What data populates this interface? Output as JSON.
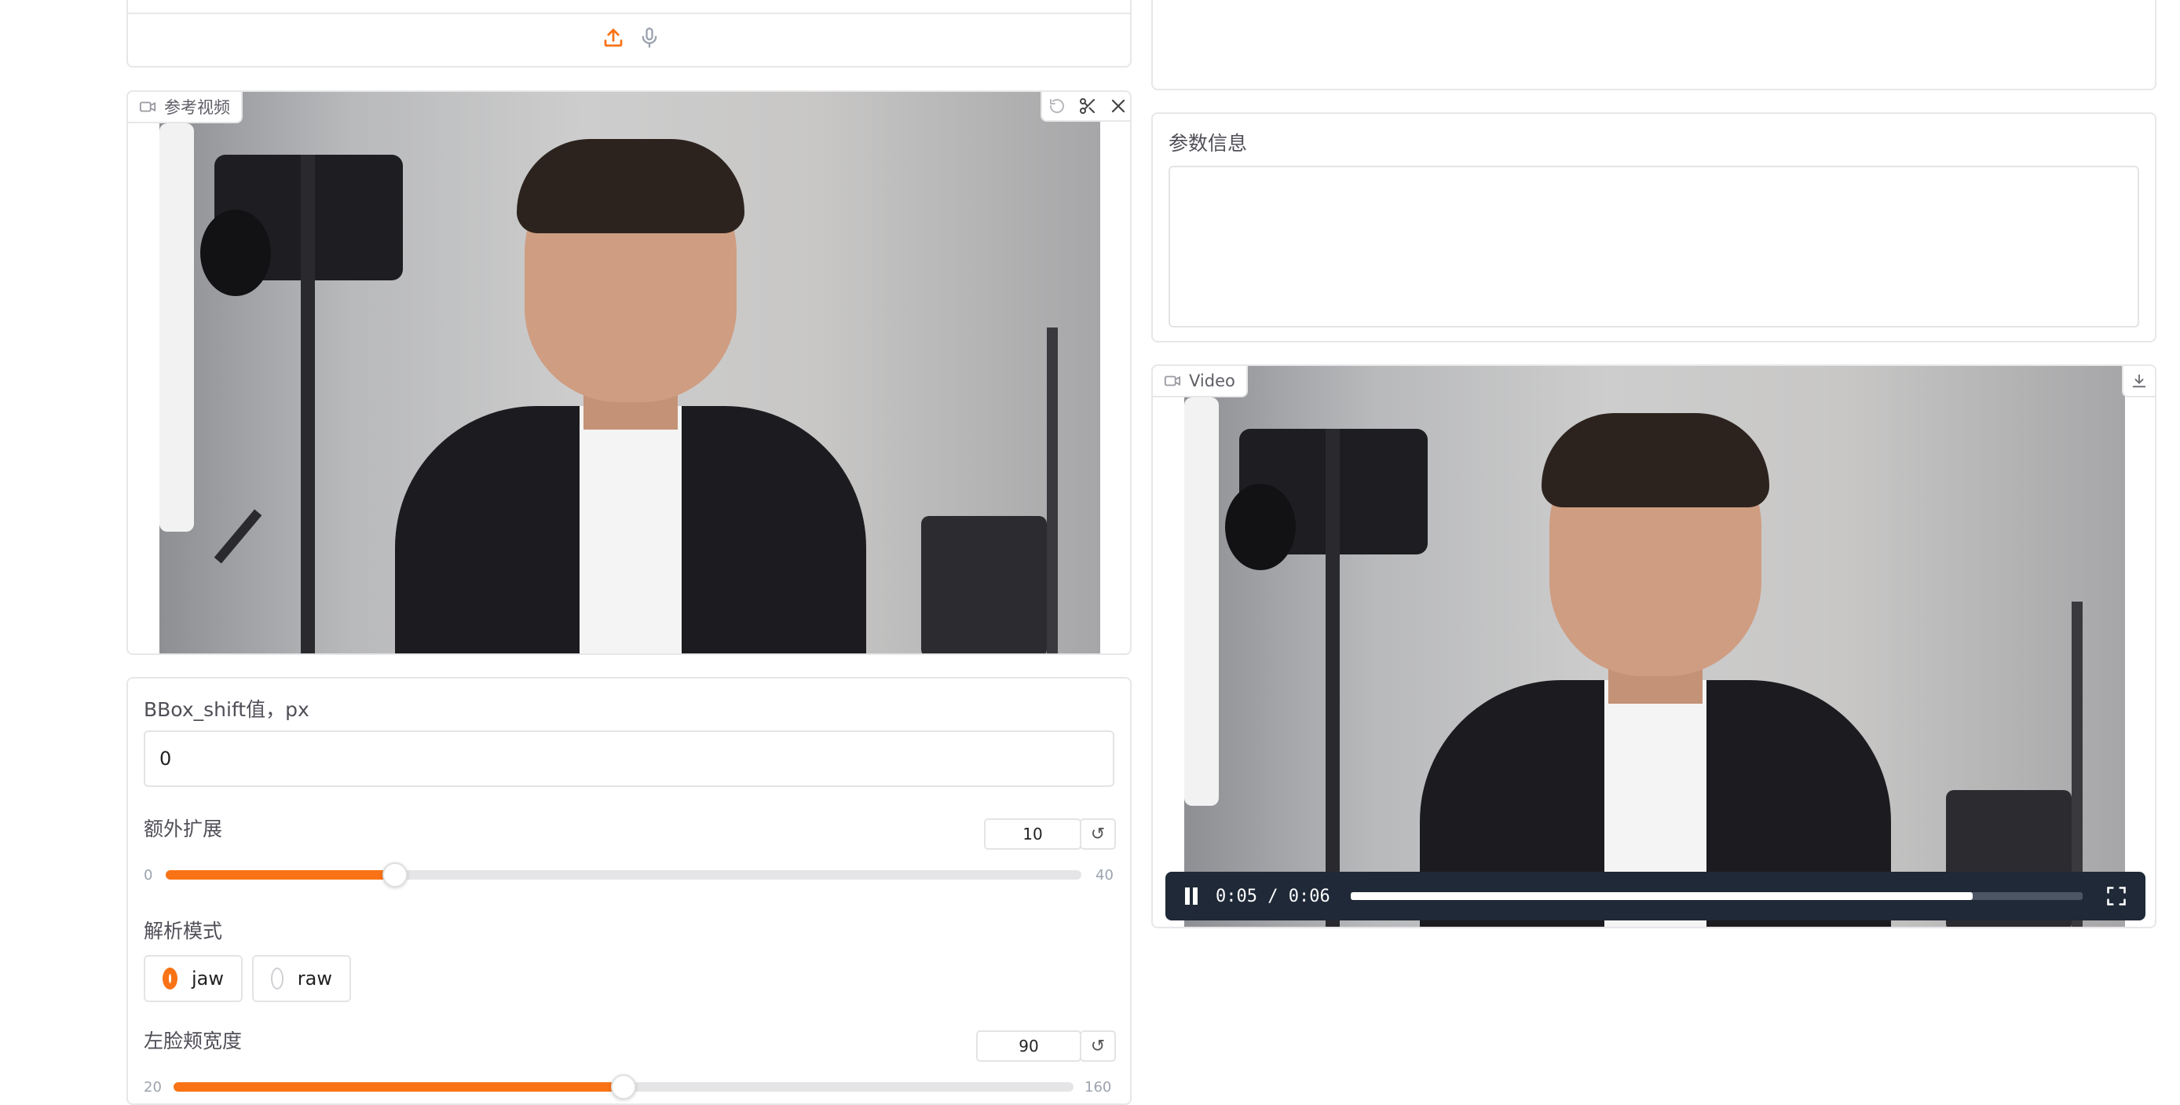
{
  "top_input": {
    "upload_icon": "upload-icon",
    "mic_icon": "microphone-icon"
  },
  "reference_video": {
    "label": "参考视频",
    "icon": "video-camera-icon",
    "actions": [
      "undo-icon",
      "scissors-icon",
      "close-icon"
    ]
  },
  "params_info": {
    "label": "参数信息",
    "value": ""
  },
  "output_video": {
    "label": "Video",
    "icon": "video-camera-icon",
    "download_icon": "download-icon",
    "time_current": "0:05",
    "time_separator": "/",
    "time_total": "0:06",
    "progress": 0.85
  },
  "controls": {
    "bbox_shift": {
      "label": "BBox_shift值，px",
      "value": "0"
    },
    "extra_margin": {
      "label": "额外扩展",
      "value": "10",
      "min": "0",
      "max": "40",
      "fraction": 0.25
    },
    "parsing_mode": {
      "label": "解析模式",
      "options": [
        "jaw",
        "raw"
      ],
      "selected": "jaw"
    },
    "left_cheek_width": {
      "label": "左脸颊宽度",
      "value": "90",
      "min": "20",
      "max": "160",
      "fraction": 0.5
    }
  },
  "colors": {
    "accent": "#f97316",
    "border": "#e7e7e9",
    "player_bar": "#1f2937"
  }
}
